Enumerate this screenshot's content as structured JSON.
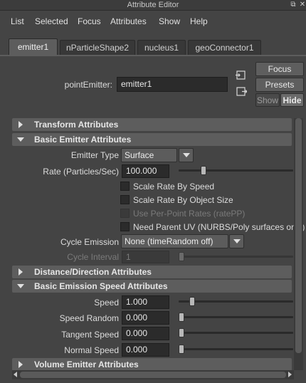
{
  "window": {
    "title": "Attribute Editor"
  },
  "menu": {
    "items": [
      "List",
      "Selected",
      "Focus",
      "Attributes",
      "Show",
      "Help"
    ]
  },
  "tabs": [
    "emitter1",
    "nParticleShape2",
    "nucleus1",
    "geoConnector1"
  ],
  "node": {
    "label": "pointEmitter:",
    "value": "emitter1"
  },
  "side_buttons": {
    "focus": "Focus",
    "presets": "Presets",
    "show": "Show",
    "hide": "Hide"
  },
  "sections": {
    "transform": "Transform Attributes",
    "basic_emitter": "Basic Emitter Attributes",
    "distance": "Distance/Direction Attributes",
    "basic_speed": "Basic Emission Speed Attributes",
    "volume": "Volume Emitter Attributes"
  },
  "basic_emitter": {
    "emitter_type_label": "Emitter Type",
    "emitter_type_value": "Surface",
    "rate_label": "Rate (Particles/Sec)",
    "rate_value": "100.000",
    "rate_slider_fraction": 0.2,
    "scale_rate_speed": "Scale Rate By Speed",
    "scale_rate_object": "Scale Rate By Object Size",
    "per_point": "Use Per-Point Rates (ratePP)",
    "need_parent_uv": "Need Parent UV (NURBS/Poly surfaces only)",
    "cycle_emission_label": "Cycle Emission",
    "cycle_emission_value": "None (timeRandom off)",
    "cycle_interval_label": "Cycle Interval",
    "cycle_interval_value": "1"
  },
  "speed": {
    "speed_label": "Speed",
    "speed_value": "1.000",
    "speed_fraction": 0.1,
    "speed_random_label": "Speed Random",
    "speed_random_value": "0.000",
    "tangent_label": "Tangent Speed",
    "tangent_value": "0.000",
    "normal_label": "Normal Speed",
    "normal_value": "0.000"
  }
}
